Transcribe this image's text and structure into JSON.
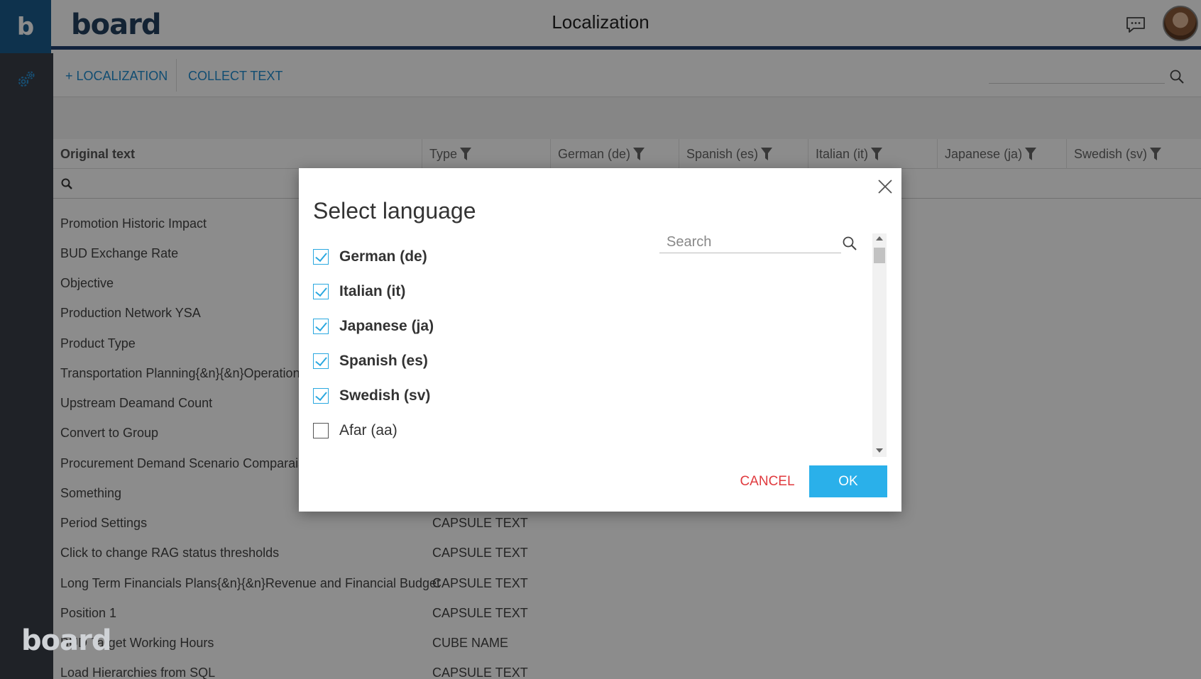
{
  "header": {
    "app_letter": "b",
    "logo_text": "board",
    "title": "Localization"
  },
  "sidebar": {
    "logo_text": "board"
  },
  "toolbar": {
    "add_localization": "+ LOCALIZATION",
    "collect_text": "COLLECT TEXT"
  },
  "grid": {
    "columns": [
      {
        "label": "Original text",
        "filter": false
      },
      {
        "label": "Type",
        "filter": true
      },
      {
        "label": "German (de)",
        "filter": true
      },
      {
        "label": "Spanish (es)",
        "filter": true
      },
      {
        "label": "Italian (it)",
        "filter": true
      },
      {
        "label": "Japanese (ja)",
        "filter": true
      },
      {
        "label": "Swedish (sv)",
        "filter": true
      }
    ],
    "rows": [
      {
        "text": "Promotion Historic Impact",
        "type": ""
      },
      {
        "text": "BUD Exchange Rate",
        "type": ""
      },
      {
        "text": "Objective",
        "type": ""
      },
      {
        "text": "Production Network YSA",
        "type": ""
      },
      {
        "text": "Product Type",
        "type": ""
      },
      {
        "text": "Transportation Planning{&n}{&n}Operations",
        "type": ""
      },
      {
        "text": "Upstream Deamand Count",
        "type": ""
      },
      {
        "text": "Convert to Group",
        "type": ""
      },
      {
        "text": "Procurement Demand Scenario Comparaiso",
        "type": ""
      },
      {
        "text": "Something",
        "type": ""
      },
      {
        "text": "Period Settings",
        "type": "CAPSULE TEXT"
      },
      {
        "text": "Click to change RAG status thresholds",
        "type": "CAPSULE TEXT"
      },
      {
        "text": "Long Term Financials Plans{&n}{&n}Revenue and Financial Budget",
        "type": "CAPSULE TEXT"
      },
      {
        "text": "Position 1",
        "type": "CAPSULE TEXT"
      },
      {
        "text": "BUD Target Working Hours",
        "type": "CUBE NAME"
      },
      {
        "text": "Load Hierarchies from SQL",
        "type": "CAPSULE TEXT"
      }
    ]
  },
  "dialog": {
    "title": "Select language",
    "search_placeholder": "Search",
    "languages": [
      {
        "label": "German (de)",
        "checked": true
      },
      {
        "label": "Italian (it)",
        "checked": true
      },
      {
        "label": "Japanese (ja)",
        "checked": true
      },
      {
        "label": "Spanish (es)",
        "checked": true
      },
      {
        "label": "Swedish (sv)",
        "checked": true
      },
      {
        "label": "Afar (aa)",
        "checked": false
      }
    ],
    "cancel_label": "CANCEL",
    "ok_label": "OK"
  },
  "colors": {
    "accent": "#2ab0ea",
    "cancel": "#e03a3e",
    "header_band": "#1f3f6e",
    "sidebar": "#3a3f47"
  }
}
